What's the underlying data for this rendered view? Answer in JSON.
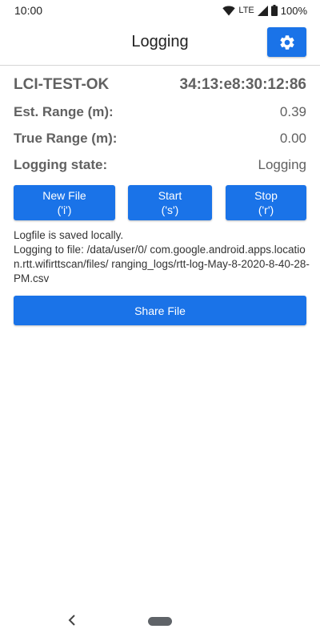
{
  "status_bar": {
    "time": "10:00",
    "network": "LTE",
    "battery": "100%"
  },
  "app_bar": {
    "title": "Logging",
    "settings_icon": "gear-icon"
  },
  "device": {
    "name": "LCI-TEST-OK",
    "mac": "34:13:e8:30:12:86"
  },
  "fields": {
    "est_range_label": "Est. Range (m):",
    "est_range_value": "0.39",
    "true_range_label": "True Range (m):",
    "true_range_value": "0.00",
    "logging_state_label": "Logging state:",
    "logging_state_value": "Logging"
  },
  "buttons": {
    "new_file_line1": "New File",
    "new_file_line2": "('i')",
    "start_line1": "Start",
    "start_line2": "('s')",
    "stop_line1": "Stop",
    "stop_line2": "('r')",
    "share": "Share File"
  },
  "info": {
    "saved": "Logfile is saved locally.",
    "path": "Logging to file: /data/user/0/ com.google.android.apps.location.rtt.wifirttscan/files/ ranging_logs/rtt-log-May-8-2020-8-40-28-PM.csv"
  },
  "colors": {
    "accent": "#1a73e8",
    "text_secondary": "#616161"
  }
}
